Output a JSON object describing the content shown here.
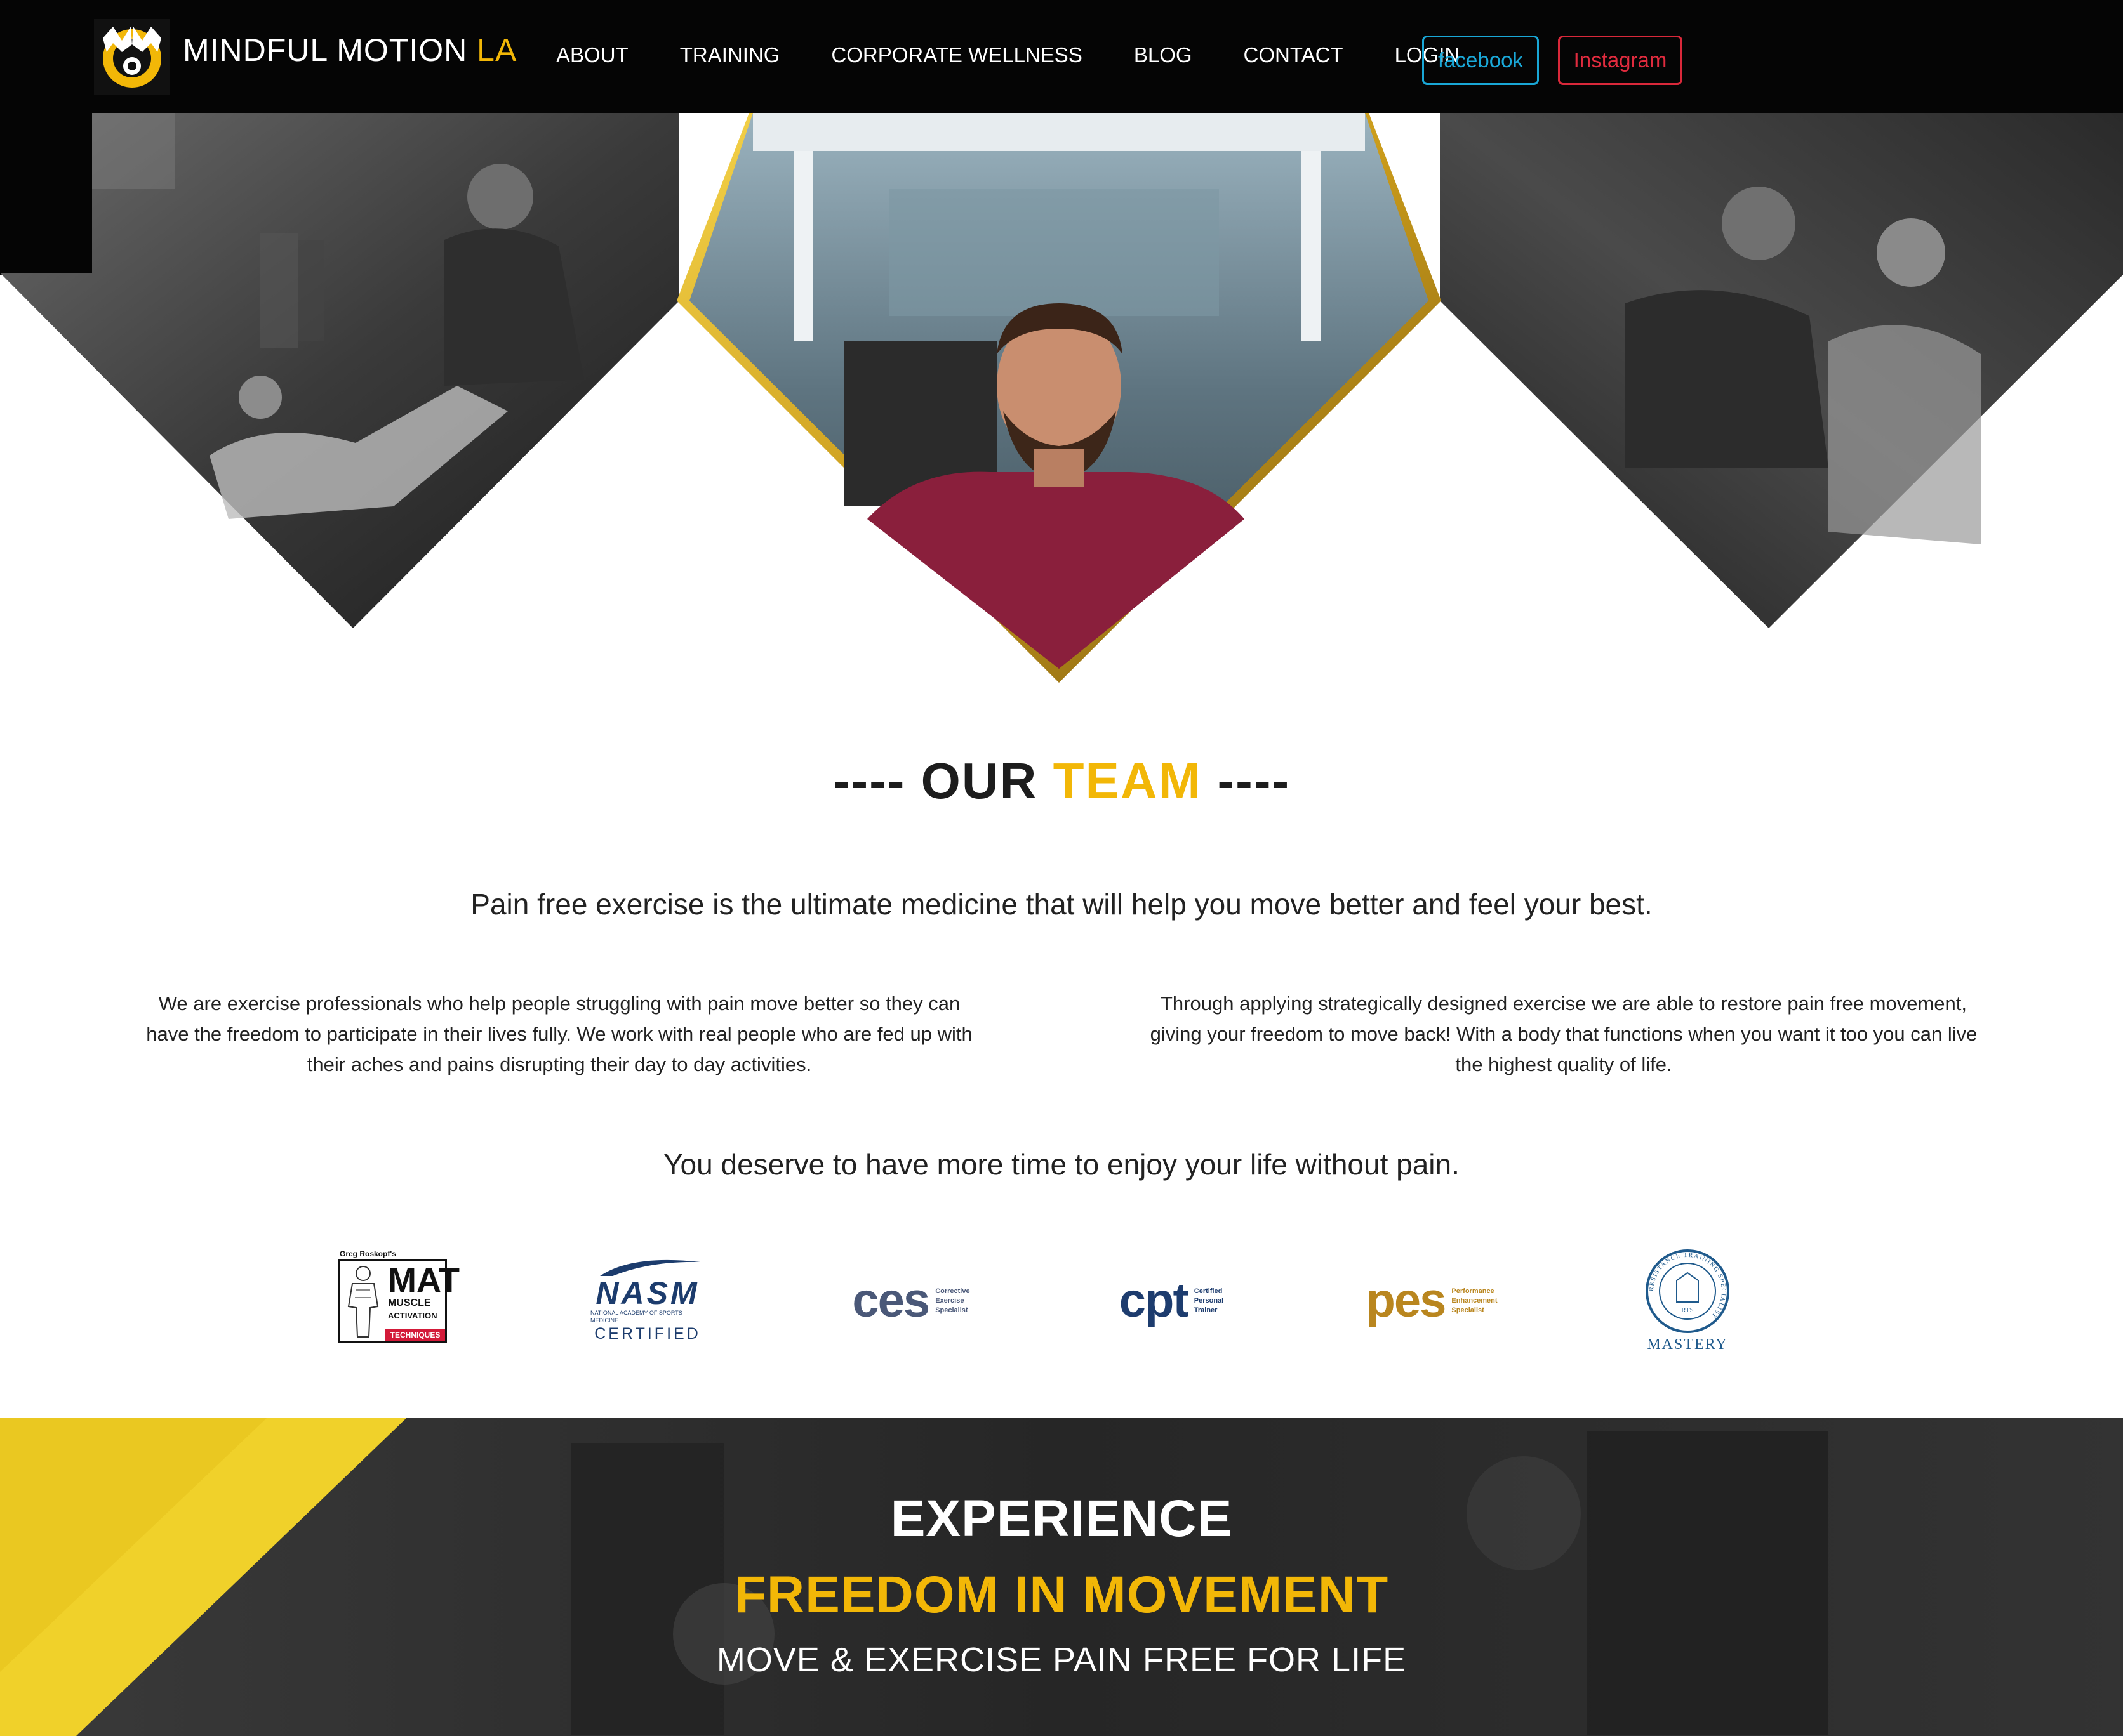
{
  "brand": {
    "name": "MINDFUL MOTION",
    "suffix": "LA",
    "monogram": "MM"
  },
  "nav": {
    "links": [
      "ABOUT",
      "TRAINING",
      "CORPORATE WELLNESS",
      "BLOG",
      "CONTACT",
      "LOGIN"
    ],
    "facebook": "facebook",
    "instagram": "Instagram"
  },
  "colors": {
    "accent": "#f2b707",
    "nav_bg": "#050505",
    "facebook": "#1aa8d8",
    "instagram": "#e02b3e"
  },
  "team": {
    "title_dashes_left": "---- ",
    "title_word1": "OUR ",
    "title_word2": "TEAM",
    "title_dashes_right": " ----",
    "tagline": "Pain free exercise is the ultimate medicine that will help you move better and feel your best.",
    "col_left": "We are exercise professionals who help people struggling with pain move better so they can have the freedom to participate in their lives fully. We work with real people who are fed up with their aches and pains disrupting their day to day activities.",
    "col_right": "Through applying strategically designed exercise we are able to restore pain free movement, giving your freedom to move back! With a body that functions when you want it too you can live the highest quality of life.",
    "deserve": "You deserve to have more time to enjoy your life without pain."
  },
  "certs": {
    "mat": {
      "top": "Greg Roskopf's",
      "big": "MAT",
      "line1": "MUSCLE",
      "line2": "ACTIVATION",
      "line3": "TECHNIQUES"
    },
    "nasm": {
      "word": "NASM",
      "sub": "NATIONAL ACADEMY OF SPORTS MEDICINE",
      "certified": "CERTIFIED"
    },
    "ces": {
      "big": "ces",
      "l1": "Corrective",
      "l2": "Exercise",
      "l3": "Specialist"
    },
    "cpt": {
      "big": "cpt",
      "l1": "Certified",
      "l2": "Personal",
      "l3": "Trainer"
    },
    "pes": {
      "big": "pes",
      "l1": "Performance",
      "l2": "Enhancement",
      "l3": "Specialist"
    },
    "rts": {
      "label": "MASTERY",
      "ring": "RESISTANCE TRAINING SPECIALIST",
      "inner": "RTS"
    }
  },
  "banner": {
    "line1": "EXPERIENCE",
    "line2": "FREEDOM IN MOVEMENT",
    "line3": "MOVE & EXERCISE PAIN FREE FOR LIFE"
  }
}
